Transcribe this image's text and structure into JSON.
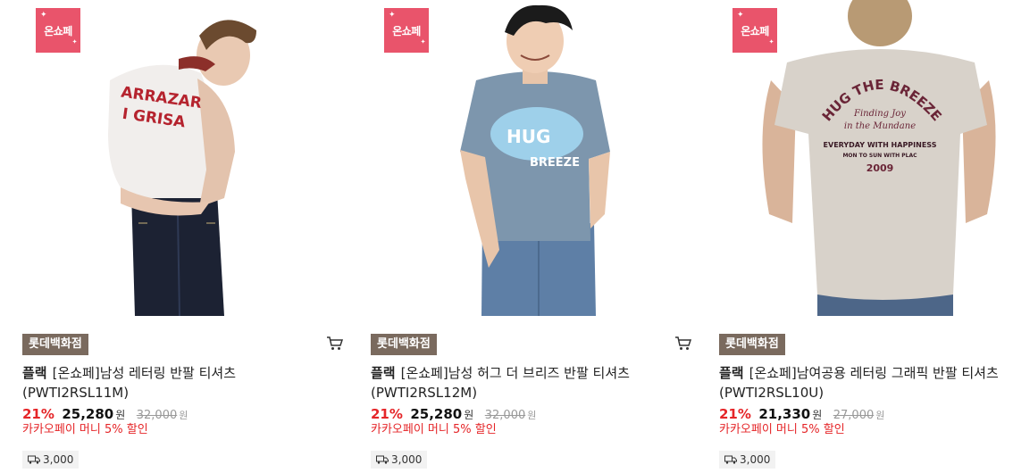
{
  "products": [
    {
      "badge": "온쇼페",
      "store": "롯데백화점",
      "brand": "플랙",
      "name": "[온쇼페]남성 레터링 반팔 티셔츠 (PWTI2RSL11M)",
      "discount": "21%",
      "price": "25,280",
      "price_unit": "원",
      "original_price": "32,000",
      "original_unit": "원",
      "promo": "카카오페이 머니 5% 할인",
      "shipping": "3,000",
      "print_lines": [
        "ARRAZAR",
        "I GRISA"
      ]
    },
    {
      "badge": "온쇼페",
      "store": "롯데백화점",
      "brand": "플랙",
      "name": "[온쇼페]남성 허그 더 브리즈 반팔 티셔츠 (PWTI2RSL12M)",
      "discount": "21%",
      "price": "25,280",
      "price_unit": "원",
      "original_price": "32,000",
      "original_unit": "원",
      "promo": "카카오페이 머니 5% 할인",
      "shipping": "3,000",
      "print_lines": [
        "HUG",
        "BREEZE"
      ]
    },
    {
      "badge": "온쇼페",
      "store": "롯데백화점",
      "brand": "플랙",
      "name": "[온쇼페]남여공용 레터링 그래픽 반팔 티셔츠 (PWTI2RSL10U)",
      "discount": "21%",
      "price": "21,330",
      "price_unit": "원",
      "original_price": "27,000",
      "original_unit": "원",
      "promo": "카카오페이 머니 5% 할인",
      "shipping": "3,000",
      "print_lines": [
        "HUG THE BREEZE",
        "Finding Joy",
        "in the Mundane",
        "EVERYDAY WITH HAPPINESS",
        "MON TO SUN WITH PLAC",
        "2009"
      ]
    }
  ],
  "colors": {
    "badge_bg": "#e9546b",
    "store_bg": "#7a6a5e",
    "discount": "#e52528",
    "promo": "#e52528"
  },
  "icons": {
    "cart": "shopping-cart-icon",
    "shipping": "delivery-truck-icon"
  }
}
